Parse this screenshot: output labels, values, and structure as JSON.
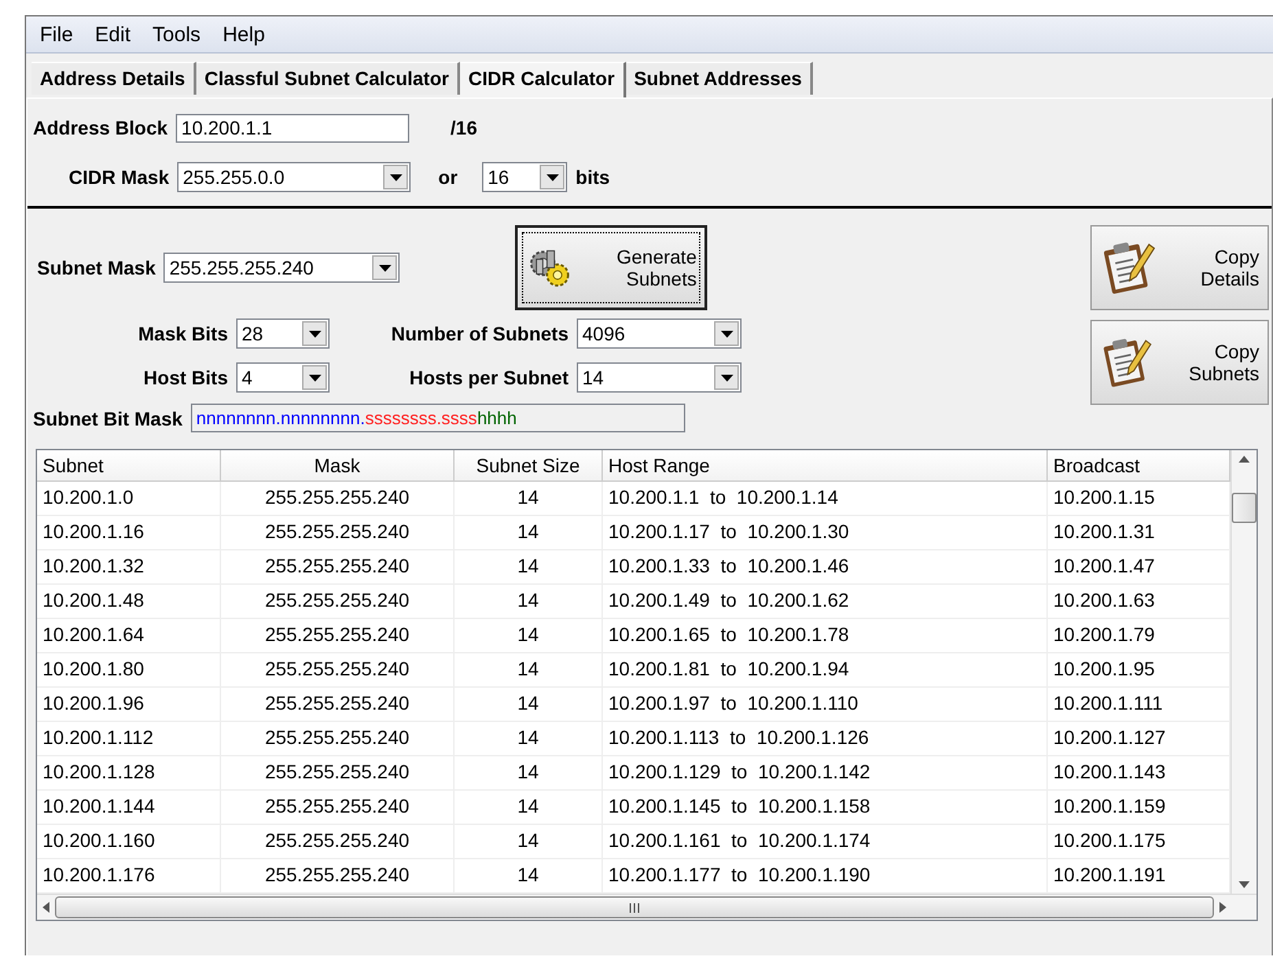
{
  "menu": [
    "File",
    "Edit",
    "Tools",
    "Help"
  ],
  "tabs": [
    {
      "label": "Address Details",
      "selected": false
    },
    {
      "label": "Classful Subnet Calculator",
      "selected": false
    },
    {
      "label": "CIDR Calculator",
      "selected": true
    },
    {
      "label": "Subnet Addresses",
      "selected": false
    }
  ],
  "address_block": {
    "label": "Address Block",
    "value": "10.200.1.1",
    "suffix": "/16"
  },
  "cidr_mask": {
    "label": "CIDR Mask",
    "value": "255.255.0.0",
    "or_label": "or",
    "bits_value": "16",
    "bits_label": "bits"
  },
  "subnet_mask": {
    "label": "Subnet Mask",
    "value": "255.255.255.240"
  },
  "generate_button": "Generate Subnets",
  "copy_buttons": [
    "Copy Details",
    "Copy Subnets"
  ],
  "mask_bits": {
    "label": "Mask Bits",
    "value": "28"
  },
  "number_of_subnets": {
    "label": "Number of Subnets",
    "value": "4096"
  },
  "host_bits": {
    "label": "Host Bits",
    "value": "4"
  },
  "hosts_per_subnet": {
    "label": "Hosts per Subnet",
    "value": "14"
  },
  "subnet_bit_mask": {
    "label": "Subnet Bit Mask",
    "parts": [
      {
        "text": "nnnnnnnn.nnnnnnnn.",
        "color": "#0000ff"
      },
      {
        "text": "ssssssss.ssss",
        "color": "#ff2020"
      },
      {
        "text": "hhhh",
        "color": "#006400"
      }
    ]
  },
  "table": {
    "columns": [
      "Subnet",
      "Mask",
      "Subnet Size",
      "Host Range",
      "Broadcast"
    ],
    "rows": [
      [
        "10.200.1.0",
        "255.255.255.240",
        "14",
        "10.200.1.1  to  10.200.1.14",
        "10.200.1.15"
      ],
      [
        "10.200.1.16",
        "255.255.255.240",
        "14",
        "10.200.1.17  to  10.200.1.30",
        "10.200.1.31"
      ],
      [
        "10.200.1.32",
        "255.255.255.240",
        "14",
        "10.200.1.33  to  10.200.1.46",
        "10.200.1.47"
      ],
      [
        "10.200.1.48",
        "255.255.255.240",
        "14",
        "10.200.1.49  to  10.200.1.62",
        "10.200.1.63"
      ],
      [
        "10.200.1.64",
        "255.255.255.240",
        "14",
        "10.200.1.65  to  10.200.1.78",
        "10.200.1.79"
      ],
      [
        "10.200.1.80",
        "255.255.255.240",
        "14",
        "10.200.1.81  to  10.200.1.94",
        "10.200.1.95"
      ],
      [
        "10.200.1.96",
        "255.255.255.240",
        "14",
        "10.200.1.97  to  10.200.1.110",
        "10.200.1.111"
      ],
      [
        "10.200.1.112",
        "255.255.255.240",
        "14",
        "10.200.1.113  to  10.200.1.126",
        "10.200.1.127"
      ],
      [
        "10.200.1.128",
        "255.255.255.240",
        "14",
        "10.200.1.129  to  10.200.1.142",
        "10.200.1.143"
      ],
      [
        "10.200.1.144",
        "255.255.255.240",
        "14",
        "10.200.1.145  to  10.200.1.158",
        "10.200.1.159"
      ],
      [
        "10.200.1.160",
        "255.255.255.240",
        "14",
        "10.200.1.161  to  10.200.1.174",
        "10.200.1.175"
      ],
      [
        "10.200.1.176",
        "255.255.255.240",
        "14",
        "10.200.1.177  to  10.200.1.190",
        "10.200.1.191"
      ]
    ]
  }
}
